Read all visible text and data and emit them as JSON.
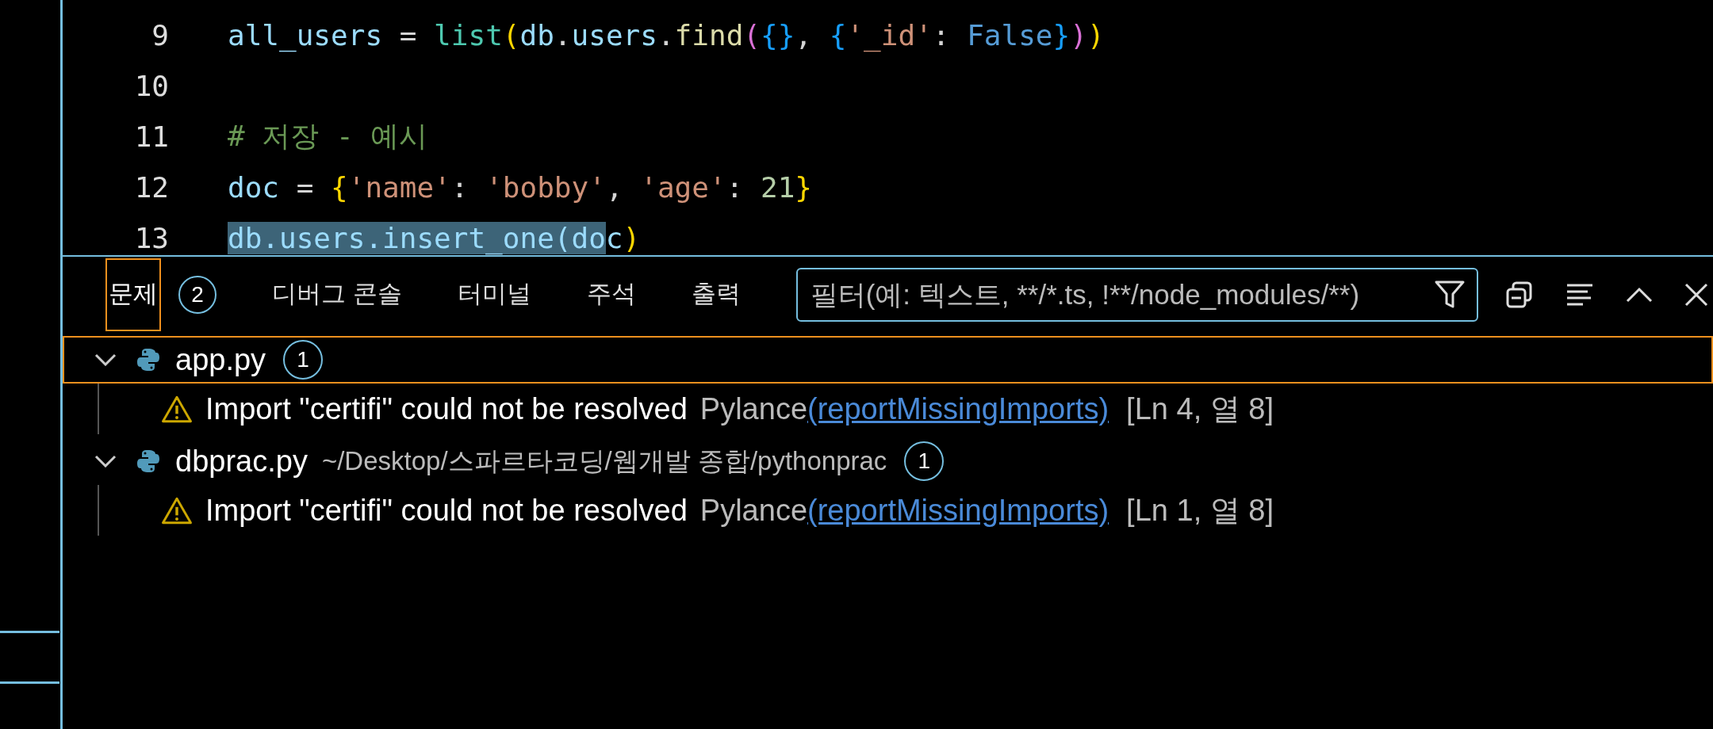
{
  "editor": {
    "lines": [
      {
        "number": "9",
        "tokens": [
          {
            "kind": "var",
            "text": "all_users"
          },
          {
            "kind": "op",
            "text": " = "
          },
          {
            "kind": "builtin",
            "text": "list"
          },
          {
            "kind": "bracket1",
            "text": "("
          },
          {
            "kind": "var",
            "text": "db"
          },
          {
            "kind": "op",
            "text": "."
          },
          {
            "kind": "var",
            "text": "users"
          },
          {
            "kind": "op",
            "text": "."
          },
          {
            "kind": "fn",
            "text": "find"
          },
          {
            "kind": "bracket2",
            "text": "("
          },
          {
            "kind": "bracket3",
            "text": "{}"
          },
          {
            "kind": "op",
            "text": ", "
          },
          {
            "kind": "bracket3",
            "text": "{"
          },
          {
            "kind": "str",
            "text": "'_id'"
          },
          {
            "kind": "op",
            "text": ": "
          },
          {
            "kind": "const",
            "text": "False"
          },
          {
            "kind": "bracket3",
            "text": "}"
          },
          {
            "kind": "bracket2",
            "text": ")"
          },
          {
            "kind": "bracket1",
            "text": ")"
          }
        ]
      },
      {
        "number": "10"
      },
      {
        "number": "11",
        "tokens": [
          {
            "kind": "comment",
            "text": "# 저장 - 예시"
          }
        ]
      },
      {
        "number": "12",
        "tokens": [
          {
            "kind": "var",
            "text": "doc"
          },
          {
            "kind": "op",
            "text": " = "
          },
          {
            "kind": "bracket1",
            "text": "{"
          },
          {
            "kind": "str",
            "text": "'name'"
          },
          {
            "kind": "op",
            "text": ": "
          },
          {
            "kind": "str",
            "text": "'bobby'"
          },
          {
            "kind": "op",
            "text": ", "
          },
          {
            "kind": "str",
            "text": "'age'"
          },
          {
            "kind": "op",
            "text": ": "
          },
          {
            "kind": "num",
            "text": "21"
          },
          {
            "kind": "bracket1",
            "text": "}"
          }
        ]
      },
      {
        "number": "13",
        "tokens": [
          {
            "kind": "selected",
            "text": "db.users.insert_one(do"
          },
          {
            "kind": "var",
            "text": "c"
          },
          {
            "kind": "bracket1",
            "text": ")"
          }
        ]
      }
    ]
  },
  "panel": {
    "tabs": [
      {
        "label": "문제",
        "badge": "2",
        "selected": true
      },
      {
        "label": "디버그 콘솔",
        "selected": false
      },
      {
        "label": "터미널",
        "selected": false
      },
      {
        "label": "주석",
        "selected": false
      },
      {
        "label": "출력",
        "selected": false
      }
    ],
    "filter": {
      "placeholder": "필터(예: 텍스트, **/*.ts, !**/node_modules/**)"
    },
    "files": [
      {
        "name": "app.py",
        "count": "1",
        "expanded": true,
        "focused": true,
        "problems": [
          {
            "message": "Import \"certifi\" could not be resolved",
            "source": "Pylance",
            "code": "(reportMissingImports)",
            "location": "[Ln 4, 열 8]"
          }
        ]
      },
      {
        "name": "dbprac.py",
        "path": "~/Desktop/스파르타코딩/웹개발 종합/pythonprac",
        "count": "1",
        "expanded": true,
        "focused": false,
        "problems": [
          {
            "message": "Import \"certifi\" could not be resolved",
            "source": "Pylance",
            "code": "(reportMissingImports)",
            "location": "[Ln 1, 열 8]"
          }
        ]
      }
    ]
  }
}
